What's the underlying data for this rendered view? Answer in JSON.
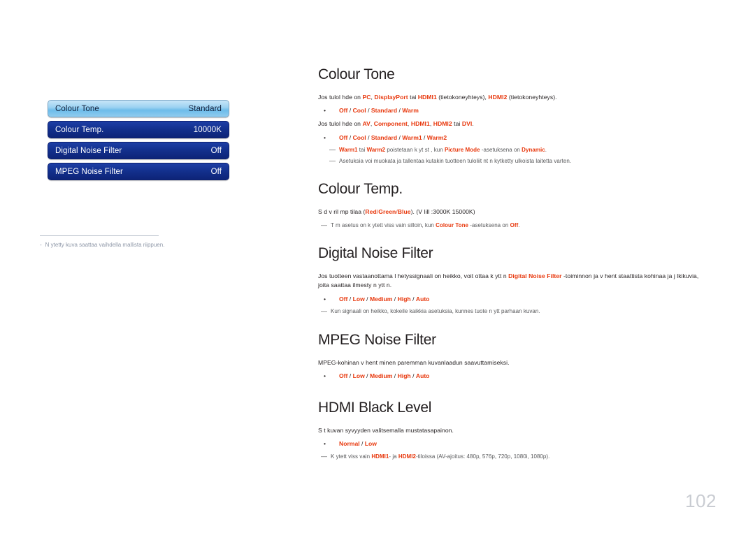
{
  "page": {
    "number": "102"
  },
  "osd_menu": {
    "rows": [
      {
        "label": "Colour Tone",
        "value": "Standard",
        "state": "selected"
      },
      {
        "label": "Colour Temp.",
        "value": "10000K",
        "state": "normal"
      },
      {
        "label": "Digital Noise Filter",
        "value": "Off",
        "state": "normal"
      },
      {
        "label": "MPEG Noise Filter",
        "value": "Off",
        "state": "normal"
      }
    ]
  },
  "left_footnote": {
    "dash": "-",
    "text": "N ytetty kuva saattaa vaihdella mallista riippuen."
  },
  "colors": {
    "accent_red": "#e8380d",
    "osd_blue": "#13308d",
    "osd_highlight": "#9cd2f2",
    "page_number_grey": "#c9ccd2"
  },
  "sections": {
    "colour_tone": {
      "title": "Colour Tone",
      "intro_pc": {
        "lead": "Jos tulol hde on ",
        "o1": "PC",
        "c1": ", ",
        "o2": "DisplayPort",
        "c2": " tai ",
        "o3": "HDMI1",
        "c3": " (tietokoneyhteys), ",
        "o4": "HDMI2",
        "c4": " (tietokoneyhteys)."
      },
      "options_pc": {
        "bullet": "•",
        "o1": "Off",
        "s1": " / ",
        "o2": "Cool",
        "s2": " / ",
        "o3": "Standard",
        "s3": " / ",
        "o4": "Warm"
      },
      "intro_av": {
        "lead": "Jos tulol hde on ",
        "o1": "AV",
        "c1": ", ",
        "o2": "Component",
        "c2": ", ",
        "o3": "HDMI1",
        "c3": ", ",
        "o4": "HDMI2",
        "c4": "  tai ",
        "o5": "DVI",
        "c5": "."
      },
      "options_av": {
        "bullet": "•",
        "o1": "Off",
        "s1": " / ",
        "o2": "Cool",
        "s2": " / ",
        "o3": "Standard",
        "s3": " / ",
        "o4": "Warm1",
        "s4": " / ",
        "o5": "Warm2"
      },
      "note1": {
        "dash": "—",
        "o1": "Warm1",
        "c1": " tai ",
        "o2": "Warm2",
        "c2": " poistetaan k yt st , kun ",
        "o3": "Picture Mode",
        "c3": " -asetuksena on ",
        "o4": "Dynamic",
        "c4": "."
      },
      "note2": {
        "dash": "—",
        "text": "Asetuksia voi muokata ja tallentaa kutakin tuotteen tuloliit nt  n kytketty  ulkoista laitetta varten."
      }
    },
    "colour_temp": {
      "title": "Colour Temp.",
      "intro": {
        "lead": "S  d  v ril mp tilaa (",
        "o1": "Red",
        "c1": "/",
        "o2": "Green",
        "c2": "/",
        "o3": "Blue",
        "c3": "). (V lill  :3000K 15000K)"
      },
      "note1": {
        "dash": "—",
        "lead": "T m  asetus on k ytett viss  vain silloin, kun ",
        "o1": "Colour Tone",
        "c1": " -asetuksena on ",
        "o2": "Off",
        "c2": "."
      }
    },
    "digital_noise_filter": {
      "title": "Digital Noise Filter",
      "intro": {
        "lead": "Jos tuotteen vastaanottama l hetyssignaali on heikko, voit ottaa k ytt  n ",
        "o1": "Digital Noise Filter",
        "tail": " -toiminnon ja v hent  staattista kohinaa ja j lkikuvia, joita saattaa ilmesty  n ytt  n."
      },
      "options": {
        "bullet": "•",
        "o1": "Off",
        "s1": " / ",
        "o2": "Low",
        "s2": " / ",
        "o3": "Medium",
        "s3": " / ",
        "o4": "High",
        "s4": " / ",
        "o5": "Auto"
      },
      "note1": {
        "dash": "—",
        "text": "Kun signaali on heikko, kokeile kaikkia asetuksia, kunnes tuote n ytt   parhaan kuvan."
      }
    },
    "mpeg_noise_filter": {
      "title": "MPEG Noise Filter",
      "intro": {
        "text": "MPEG-kohinan v hent minen paremman kuvanlaadun saavuttamiseksi."
      },
      "options": {
        "bullet": "•",
        "o1": "Off",
        "s1": " / ",
        "o2": "Low",
        "s2": " / ",
        "o3": "Medium",
        "s3": " / ",
        "o4": "High",
        "s4": " / ",
        "o5": "Auto"
      }
    },
    "hdmi_black_level": {
      "title": "HDMI Black Level",
      "intro": {
        "text": "S t  kuvan syvyyden valitsemalla mustatasapainon."
      },
      "options": {
        "bullet": "•",
        "o1": "Normal",
        "s1": " / ",
        "o2": "Low"
      },
      "note1": {
        "dash": "—",
        "lead": "K ytett viss  vain ",
        "o1": "HDMI1",
        "c1": "- ja ",
        "o2": "HDMI2",
        "c2": "-tiloissa (AV-ajoitus: 480p, 576p, 720p, 1080i, 1080p)."
      }
    }
  }
}
